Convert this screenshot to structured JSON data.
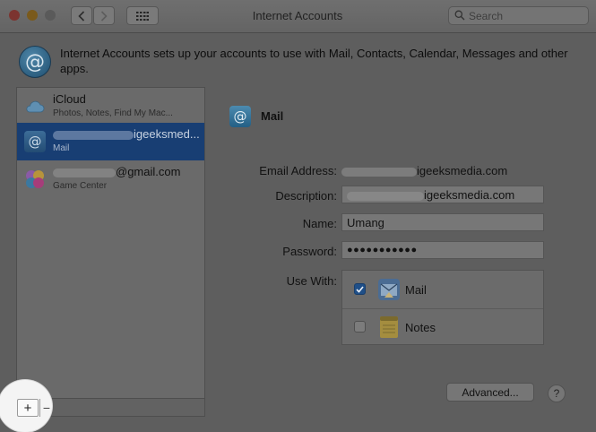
{
  "window": {
    "title": "Internet Accounts",
    "traffic_lights": [
      "close",
      "minimize",
      "zoom"
    ],
    "nav": {
      "back_icon": "chevron-left-icon",
      "forward_icon": "chevron-right-icon",
      "show_all_icon": "grid-icon"
    },
    "search": {
      "placeholder": "Search",
      "icon": "search-icon"
    }
  },
  "header": {
    "icon": "at-sign-icon",
    "icon_glyph": "@",
    "text": "Internet Accounts sets up your accounts to use with Mail, Contacts, Calendar, Messages and other apps."
  },
  "accounts": [
    {
      "name": "iCloud",
      "subtitle": "Photos, Notes, Find My Mac...",
      "icon": "icloud-icon",
      "selected": false
    },
    {
      "name_visible": "igeeksmed...",
      "subtitle": "Mail",
      "icon": "at-sign-icon",
      "icon_glyph": "@",
      "selected": true
    },
    {
      "name_visible": "@gmail.com",
      "subtitle": "Game Center",
      "icon": "game-center-icon",
      "selected": false
    }
  ],
  "sidebar_footer": {
    "add_label": "+",
    "remove_label": "−"
  },
  "detail": {
    "icon": "at-sign-icon",
    "icon_glyph": "@",
    "title": "Mail",
    "labels": {
      "email": "Email Address:",
      "description": "Description:",
      "name": "Name:",
      "password": "Password:",
      "use_with": "Use With:"
    },
    "values": {
      "email_visible": "igeeksmedia.com",
      "description_visible": "igeeksmedia.com",
      "name": "Umang",
      "password": "●●●●●●●●●●●"
    },
    "apps": [
      {
        "name": "Mail",
        "checked": true,
        "icon": "mail-app-icon"
      },
      {
        "name": "Notes",
        "checked": false,
        "icon": "notes-app-icon"
      }
    ],
    "advanced_label": "Advanced...",
    "help_label": "?"
  },
  "colors": {
    "selection": "#183e73",
    "checkbox_checked": "#1f4f88",
    "spotlight": "#f4f4f4"
  }
}
